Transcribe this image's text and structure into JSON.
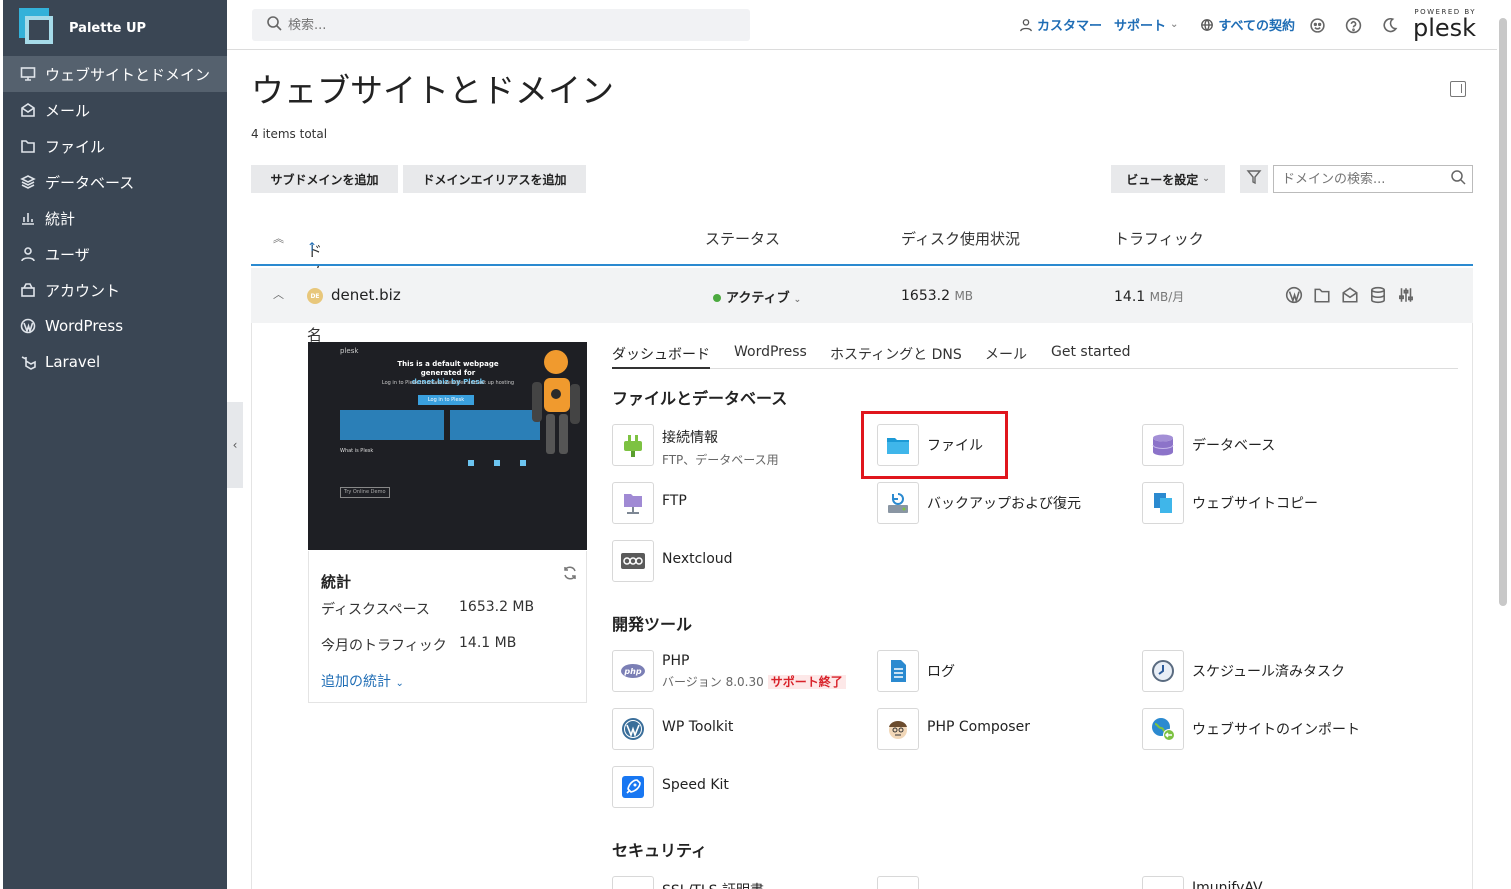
{
  "app": {
    "name": "Palette UP"
  },
  "sidebar": {
    "items": [
      {
        "label": "ウェブサイトとドメイン",
        "icon": "monitor-icon"
      },
      {
        "label": "メール",
        "icon": "mail-icon"
      },
      {
        "label": "ファイル",
        "icon": "folder-icon"
      },
      {
        "label": "データベース",
        "icon": "database-icon"
      },
      {
        "label": "統計",
        "icon": "bar-chart-icon"
      },
      {
        "label": "ユーザ",
        "icon": "user-icon"
      },
      {
        "label": "アカウント",
        "icon": "account-icon"
      },
      {
        "label": "WordPress",
        "icon": "wordpress-icon"
      },
      {
        "label": "Laravel",
        "icon": "laravel-icon"
      }
    ]
  },
  "topbar": {
    "search_placeholder": "検索...",
    "customer": "カスタマー",
    "support": "サポート",
    "subscriptions": "すべての契約",
    "powered_by": "POWERED BY",
    "plesk": "plesk"
  },
  "page": {
    "title": "ウェブサイトとドメイン",
    "items_total": "4 items total",
    "add_subdomain": "サブドメインを追加",
    "add_alias": "ドメインエイリアスを追加",
    "view_settings": "ビューを設定",
    "domain_search_placeholder": "ドメインの検索..."
  },
  "table": {
    "columns": [
      "ドメイン名",
      "ステータス",
      "ディスク使用状況",
      "トラフィック"
    ],
    "row": {
      "domain": "denet.biz",
      "logo_text": "DE",
      "status": "アクティブ",
      "disk_value": "1653.2",
      "disk_unit": "MB",
      "traffic_value": "14.1",
      "traffic_unit": "MB/月"
    }
  },
  "preview": {
    "brand": "plesk",
    "title_line1": "This is a default webpage generated for",
    "title_line2": "denet.biz by Plesk",
    "sub": "Log in to Plesk to create websites and set up hosting",
    "button": "Log in to Plesk",
    "what": "What is Plesk",
    "try": "Try Online Demo"
  },
  "stats": {
    "title": "統計",
    "disk_label": "ディスクスペース",
    "disk_value": "1653.2 MB",
    "traffic_label": "今月のトラフィック",
    "traffic_value": "14.1 MB",
    "more": "追加の統計"
  },
  "tabs": [
    "ダッシュボード",
    "WordPress",
    "ホスティングと DNS",
    "メール",
    "Get started"
  ],
  "sections": {
    "files_db": "ファイルとデータベース",
    "dev_tools": "開発ツール",
    "security": "セキュリティ"
  },
  "tools": {
    "connection": {
      "label": "接続情報",
      "sub": "FTP、データベース用"
    },
    "files": {
      "label": "ファイル"
    },
    "databases": {
      "label": "データベース"
    },
    "ftp": {
      "label": "FTP"
    },
    "backup": {
      "label": "バックアップおよび復元"
    },
    "site_copy": {
      "label": "ウェブサイトコピー"
    },
    "nextcloud": {
      "label": "Nextcloud"
    },
    "php": {
      "label": "PHP",
      "sub": "バージョン 8.0.30",
      "badge": "サポート終了"
    },
    "logs": {
      "label": "ログ"
    },
    "scheduled": {
      "label": "スケジュール済みタスク"
    },
    "wptoolkit": {
      "label": "WP Toolkit"
    },
    "composer": {
      "label": "PHP Composer"
    },
    "import": {
      "label": "ウェブサイトのインポート"
    },
    "speedkit": {
      "label": "Speed Kit"
    },
    "ssl": {
      "label": "SSL/TLS 証明書"
    },
    "imunify": {
      "label": "ImunifyAV"
    }
  },
  "colors": {
    "sidebar": "#3a4654",
    "accent": "#1f6db5",
    "highlight": "#e0161d",
    "active": "#4caa3f"
  }
}
